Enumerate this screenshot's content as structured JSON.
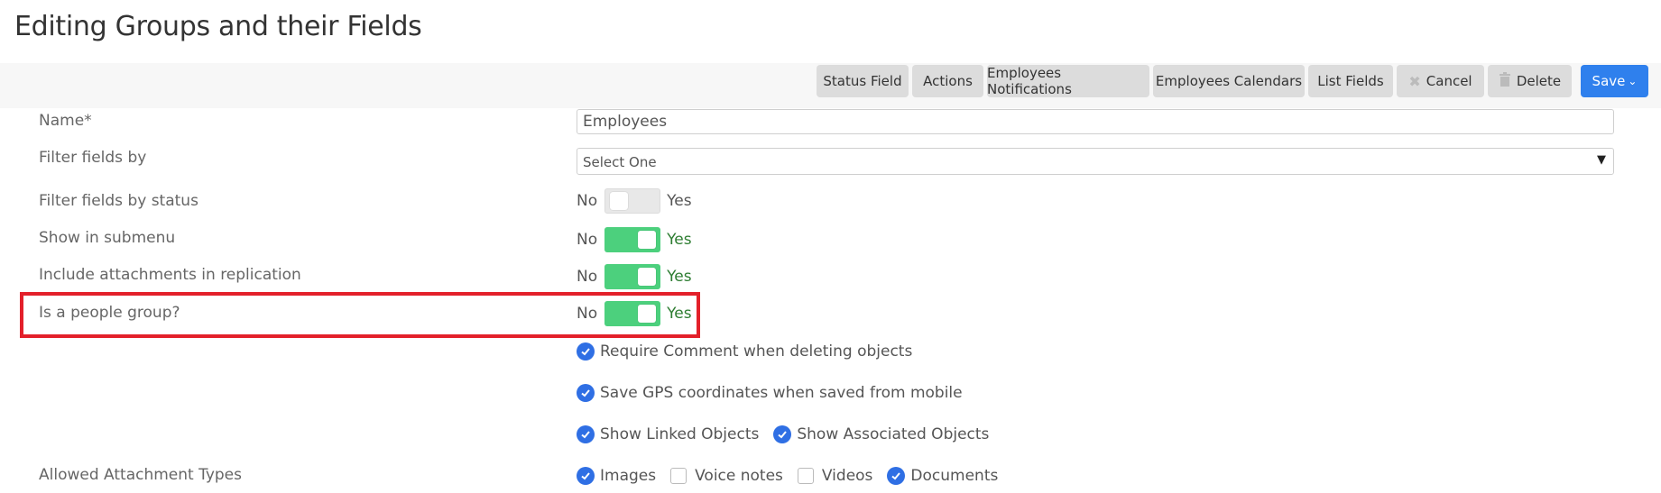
{
  "page": {
    "title": "Editing Groups and their Fields"
  },
  "toolbar": {
    "status_field": "Status Field",
    "actions": "Actions",
    "employees_notifications": "Employees Notifications",
    "employees_calendars": "Employees Calendars",
    "list_fields": "List Fields",
    "cancel": "Cancel",
    "delete": "Delete",
    "save": "Save",
    "save_caret": "⌄"
  },
  "form": {
    "name": {
      "label": "Name*",
      "value": "Employees"
    },
    "filter_fields_by": {
      "label": "Filter fields by",
      "selected": "Select One"
    },
    "filter_fields_by_status": {
      "label": "Filter fields by status",
      "no": "No",
      "yes": "Yes",
      "on": false
    },
    "show_in_submenu": {
      "label": "Show in submenu",
      "no": "No",
      "yes": "Yes",
      "on": true
    },
    "include_attachments": {
      "label": "Include attachments in replication",
      "no": "No",
      "yes": "Yes",
      "on": true
    },
    "people_group": {
      "label": "Is a people group?",
      "no": "No",
      "yes": "Yes",
      "on": true
    },
    "require_comment": {
      "label": "Require Comment when deleting objects",
      "checked": true
    },
    "save_gps": {
      "label": "Save GPS coordinates when saved from mobile",
      "checked": true
    },
    "show_linked": {
      "label": "Show Linked Objects",
      "checked": true
    },
    "show_associated": {
      "label": "Show Associated Objects",
      "checked": true
    },
    "allowed_attachment_types": {
      "label": "Allowed Attachment Types",
      "options": [
        {
          "label": "Images",
          "checked": true
        },
        {
          "label": "Voice notes",
          "checked": false
        },
        {
          "label": "Videos",
          "checked": false
        },
        {
          "label": "Documents",
          "checked": true
        }
      ]
    }
  },
  "colors": {
    "accent": "#2f80ed",
    "toggle_on": "#4cd07d",
    "highlight": "#e3202a"
  }
}
